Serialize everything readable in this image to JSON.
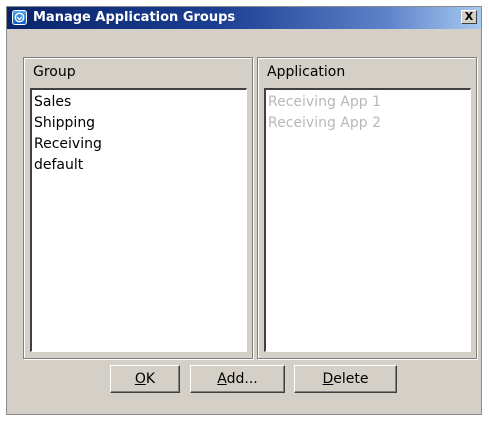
{
  "window": {
    "title": "Manage Application Groups",
    "close_label": "X",
    "icon": "app-logo-icon"
  },
  "group_panel": {
    "header": "Group",
    "items": [
      "Sales",
      "Shipping",
      "Receiving",
      "default"
    ]
  },
  "application_panel": {
    "header": "Application",
    "items": [
      "Receiving App 1",
      "Receiving App 2"
    ],
    "enabled": false
  },
  "buttons": {
    "ok": {
      "mnemonic": "O",
      "rest": "K"
    },
    "add": {
      "mnemonic": "A",
      "rest": "dd..."
    },
    "delete": {
      "mnemonic": "D",
      "rest": "elete"
    }
  },
  "colors": {
    "titlebar_start": "#0a246a",
    "titlebar_end": "#a6caf0",
    "dialog_bg": "#d4d0c8",
    "disabled_text": "#b8b8b8"
  }
}
